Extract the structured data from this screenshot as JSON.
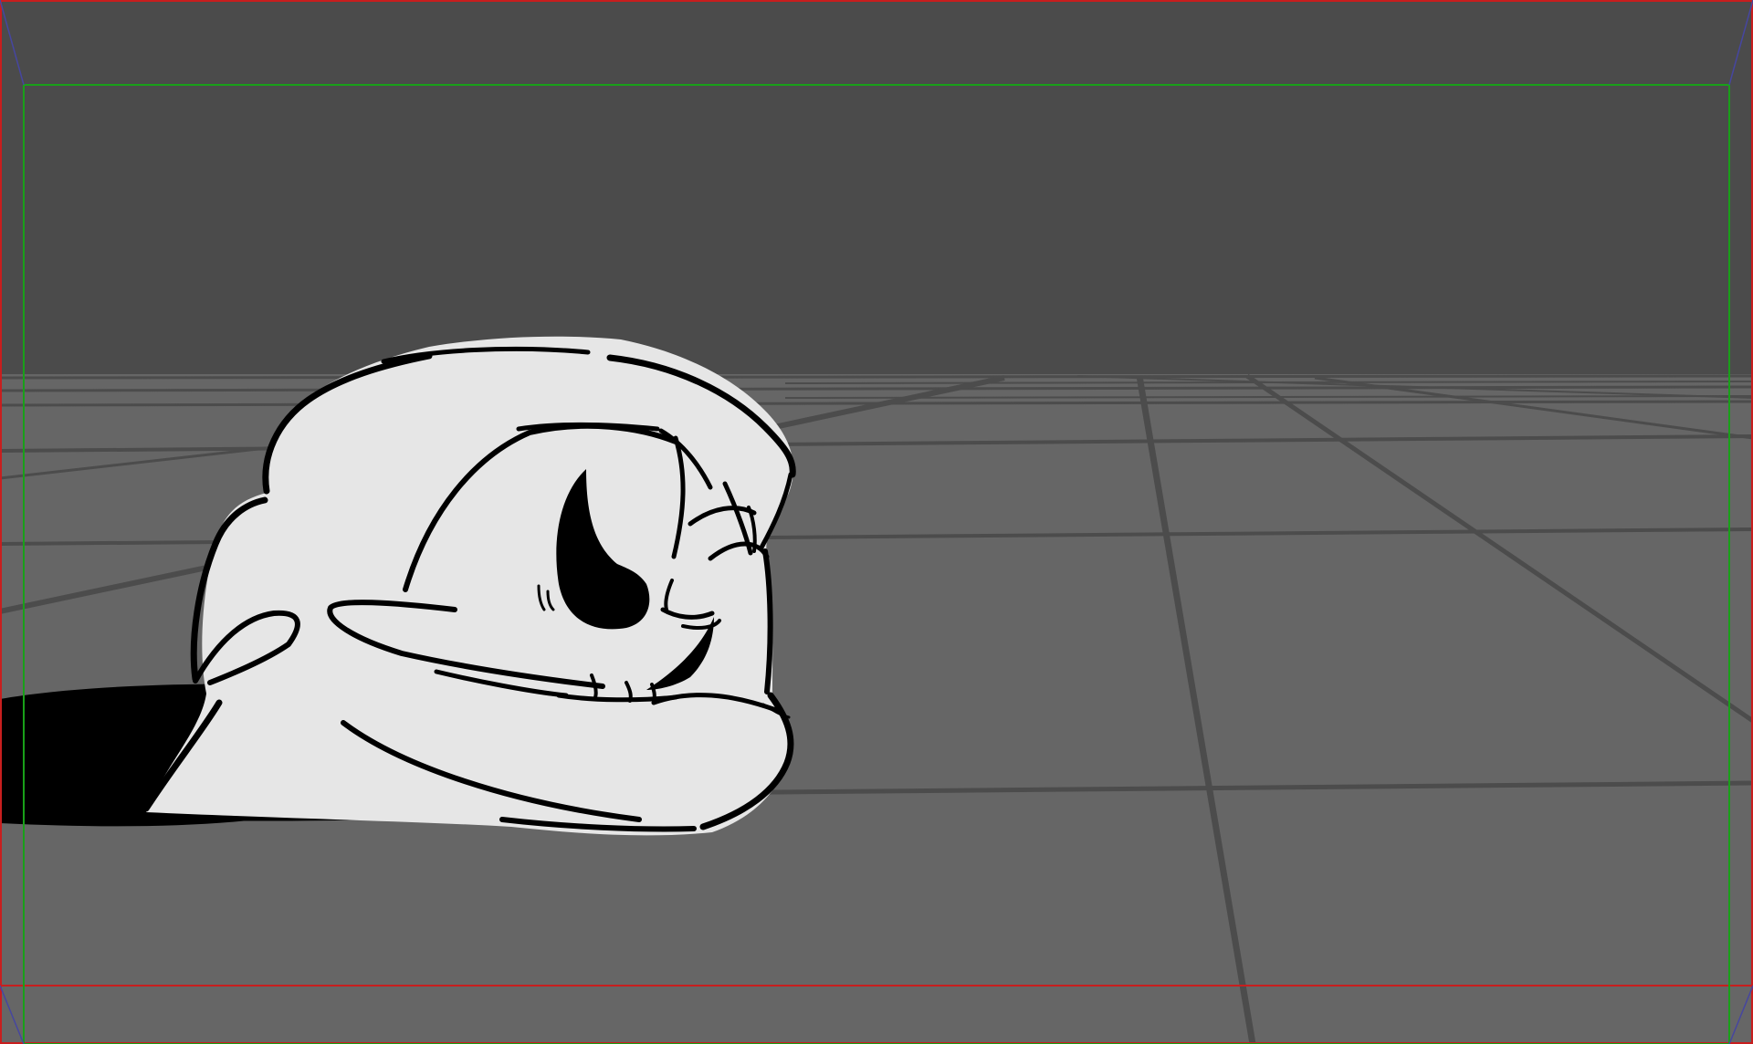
{
  "scene": {
    "subject": "skull-sketch",
    "colors": {
      "sky": "#4b4b4b",
      "floor": "#666666",
      "grid_line": "#4a4a4a",
      "skull_fill": "#e6e6e6",
      "ink": "#000000",
      "shadow": "#000000",
      "frame_red": "#c81e1e",
      "frame_green": "#19a019",
      "frame_blue": "#4646a0"
    },
    "guides": [
      "outer-frame",
      "safe-frame",
      "corner-diagonals"
    ]
  }
}
